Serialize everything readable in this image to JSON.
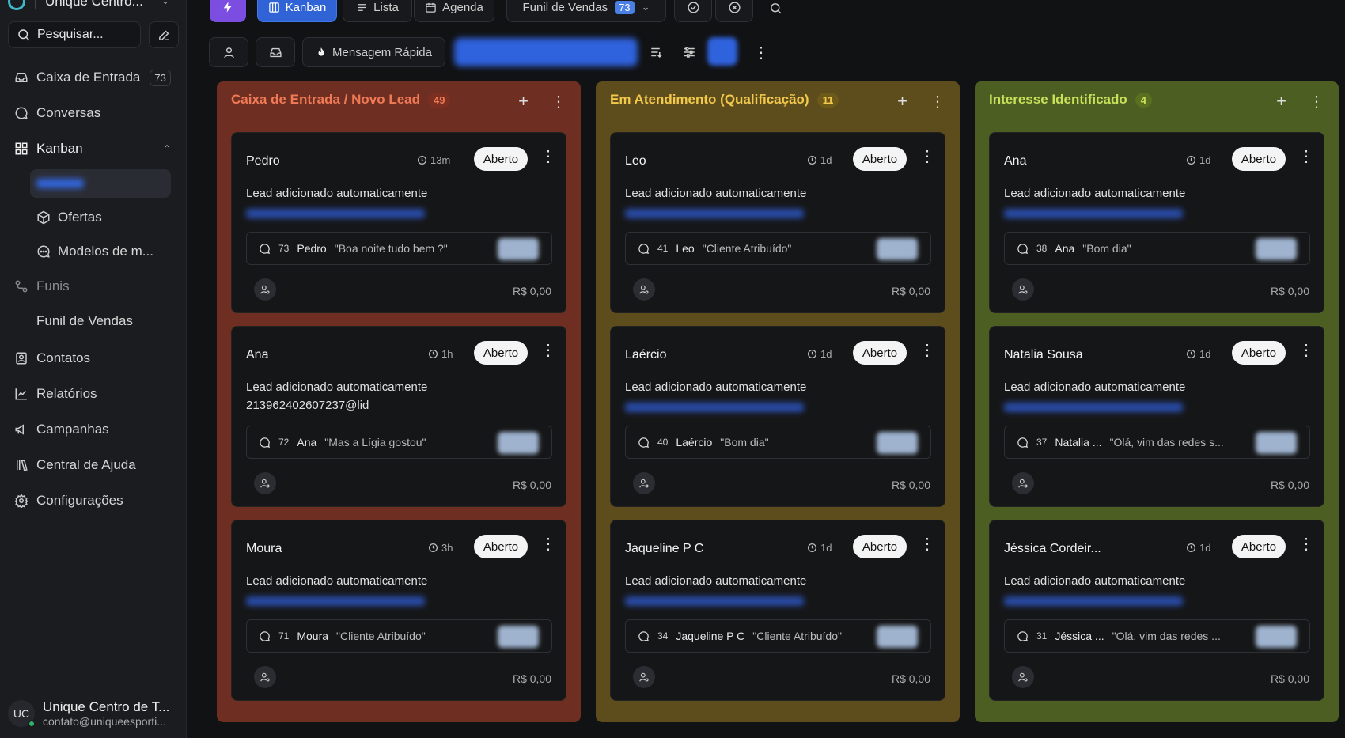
{
  "sidebar": {
    "brand_name": "Unique Centro...",
    "search_label": "Pesquisar...",
    "nav": {
      "inbox": {
        "label": "Caixa de Entrada",
        "badge": "73"
      },
      "conversations": {
        "label": "Conversas"
      },
      "kanban": {
        "label": "Kanban"
      },
      "funis": {
        "label": "Funis"
      },
      "contatos": {
        "label": "Contatos"
      },
      "relatorios": {
        "label": "Relatórios"
      },
      "campanhas": {
        "label": "Campanhas"
      },
      "ajuda": {
        "label": "Central de Ajuda"
      },
      "config": {
        "label": "Configurações"
      }
    },
    "kanban_sub": {
      "ofertas": "Ofertas",
      "modelos": "Modelos de m..."
    },
    "funis_sub": {
      "funil_vendas": "Funil de Vendas"
    },
    "user": {
      "initials": "UC",
      "name": "Unique Centro de T...",
      "email": "contato@uniqueesporti..."
    }
  },
  "toolbar": {
    "kanban": "Kanban",
    "lista": "Lista",
    "agenda": "Agenda",
    "funnel": {
      "label": "Funil de Vendas",
      "count": "73"
    },
    "quick_message": "Mensagem Rápida"
  },
  "columns": [
    {
      "title": "Caixa de Entrada / Novo Lead",
      "count": "49",
      "color": "#6e2f22",
      "title_color": "#f07a55",
      "count_bg": "#7a2f20",
      "cards": [
        {
          "name": "Pedro",
          "time": "13m",
          "status": "Aberto",
          "desc": "Lead adicionado automaticamente",
          "sub": "",
          "msg_count": "73",
          "msg_name": "Pedro",
          "msg_text": "\"Boa noite tudo bem ?\"",
          "value": "R$ 0,00"
        },
        {
          "name": "Ana",
          "time": "1h",
          "status": "Aberto",
          "desc": "Lead adicionado automaticamente",
          "sub": "213962402607237@lid",
          "msg_count": "72",
          "msg_name": "Ana",
          "msg_text": "\"Mas a Lígia gostou\"",
          "value": "R$ 0,00"
        },
        {
          "name": "Moura",
          "time": "3h",
          "status": "Aberto",
          "desc": "Lead adicionado automaticamente",
          "sub": "",
          "msg_count": "71",
          "msg_name": "Moura",
          "msg_text": "\"Cliente Atribuído\"",
          "value": "R$ 0,00"
        }
      ]
    },
    {
      "title": "Em Atendimento (Qualificação)",
      "count": "11",
      "color": "#5e4d1c",
      "title_color": "#f2c94c",
      "count_bg": "#6d5a18",
      "cards": [
        {
          "name": "Leo",
          "time": "1d",
          "status": "Aberto",
          "desc": "Lead adicionado automaticamente",
          "sub": "",
          "msg_count": "41",
          "msg_name": "Leo",
          "msg_text": "\"Cliente Atribuído\"",
          "value": "R$ 0,00"
        },
        {
          "name": "Laércio",
          "time": "1d",
          "status": "Aberto",
          "desc": "Lead adicionado automaticamente",
          "sub": "",
          "msg_count": "40",
          "msg_name": "Laércio",
          "msg_text": "\"Bom dia\"",
          "value": "R$ 0,00"
        },
        {
          "name": "Jaqueline P C",
          "time": "1d",
          "status": "Aberto",
          "desc": "Lead adicionado automaticamente",
          "sub": "",
          "msg_count": "34",
          "msg_name": "Jaqueline P C",
          "msg_text": "\"Cliente Atribuído\"",
          "value": "R$ 0,00"
        }
      ]
    },
    {
      "title": "Interesse Identificado",
      "count": "4",
      "color": "#4c5e22",
      "title_color": "#c8e05a",
      "count_bg": "#5a6f20",
      "cards": [
        {
          "name": "Ana",
          "time": "1d",
          "status": "Aberto",
          "desc": "Lead adicionado automaticamente",
          "sub": "",
          "msg_count": "38",
          "msg_name": "Ana",
          "msg_text": "\"Bom dia\"",
          "value": "R$ 0,00"
        },
        {
          "name": "Natalia Sousa",
          "time": "1d",
          "status": "Aberto",
          "desc": "Lead adicionado automaticamente",
          "sub": "",
          "msg_count": "37",
          "msg_name": "Natalia ...",
          "msg_text": "\"Olá, vim das redes s...",
          "value": "R$ 0,00"
        },
        {
          "name": "Jéssica Cordeir...",
          "time": "1d",
          "status": "Aberto",
          "desc": "Lead adicionado automaticamente",
          "sub": "",
          "msg_count": "31",
          "msg_name": "Jéssica ...",
          "msg_text": "\"Olá, vim das redes ...",
          "value": "R$ 0,00"
        }
      ]
    }
  ]
}
